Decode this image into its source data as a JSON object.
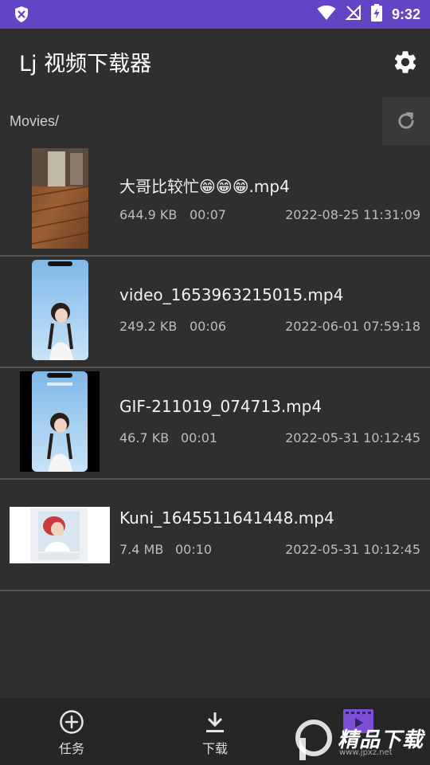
{
  "status_bar": {
    "time": "9:32",
    "icons": [
      "shield-x-icon",
      "wifi-icon",
      "no-signal-icon",
      "battery-charging-icon"
    ]
  },
  "app_bar": {
    "title": "Lj 视频下载器",
    "settings_icon": "gear-icon"
  },
  "path_bar": {
    "path": "Movies/",
    "refresh_icon": "refresh-icon"
  },
  "files": [
    {
      "name": "大哥比较忙😁😁😁.mp4",
      "size": "644.9 KB",
      "duration": "00:07",
      "date": "2022-08-25 11:31:09"
    },
    {
      "name": "video_1653963215015.mp4",
      "size": "249.2 KB",
      "duration": "00:06",
      "date": "2022-06-01 07:59:18"
    },
    {
      "name": "GIF-211019_074713.mp4",
      "size": "46.7 KB",
      "duration": "00:01",
      "date": "2022-05-31 10:12:45"
    },
    {
      "name": "Kuni_1645511641448.mp4",
      "size": "7.4 MB",
      "duration": "00:10",
      "date": "2022-05-31 10:12:45"
    }
  ],
  "bottom_nav": {
    "items": [
      {
        "label": "任务",
        "icon": "add-circle-icon"
      },
      {
        "label": "下载",
        "icon": "download-icon"
      },
      {
        "label": "",
        "icon": "video-folder-icon"
      }
    ]
  },
  "watermark": {
    "text": "精品下载",
    "sub": "www.jpxz.net"
  },
  "colors": {
    "status_bar": "#6244c5",
    "background": "#2f2f2f",
    "accent_purple": "#7b4fd6"
  }
}
